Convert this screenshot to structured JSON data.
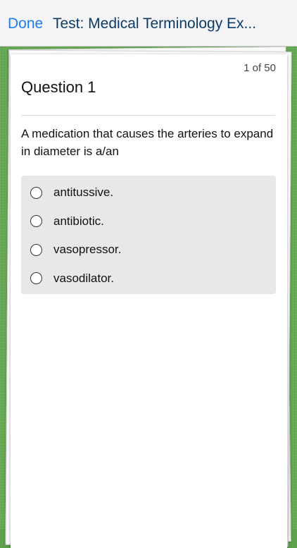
{
  "navbar": {
    "done_label": "Done",
    "title": "Test: Medical Terminology Ex..."
  },
  "quiz": {
    "counter": "1 of 50",
    "question_title": "Question 1",
    "question_text": "A medication that causes the arteries to expand in diameter is a/an",
    "options": [
      {
        "label": "antitussive.",
        "selected": false
      },
      {
        "label": "antibiotic.",
        "selected": false
      },
      {
        "label": "vasopressor.",
        "selected": false
      },
      {
        "label": "vasodilator.",
        "selected": false
      }
    ]
  },
  "colors": {
    "accent": "#1a7ff0",
    "title": "#0d3a66",
    "background": "#5fa24e"
  }
}
